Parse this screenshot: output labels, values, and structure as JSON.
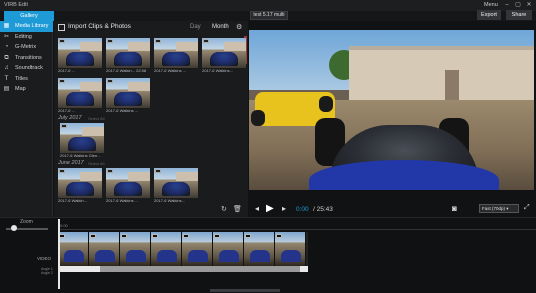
{
  "titlebar": {
    "title": "VIRB Edit",
    "menu_label": "Menu",
    "min": "–",
    "max": "▢",
    "close": "✕"
  },
  "topbar": {
    "gallery_label": "Gallery",
    "project_name": "test 5.17 multi",
    "export_label": "Export",
    "share_label": "Share"
  },
  "sidebar": {
    "items": [
      {
        "label": "Media Library",
        "icon": "film-icon",
        "glyph": "▦"
      },
      {
        "label": "Editing",
        "icon": "scissors-icon",
        "glyph": "✂"
      },
      {
        "label": "G-Metrix",
        "icon": "gauge-icon",
        "glyph": "◔"
      },
      {
        "label": "Transitions",
        "icon": "transitions-icon",
        "glyph": "⧉"
      },
      {
        "label": "Soundtrack",
        "icon": "music-icon",
        "glyph": "♫"
      },
      {
        "label": "Titles",
        "icon": "titles-icon",
        "glyph": "T"
      },
      {
        "label": "Map",
        "icon": "map-icon",
        "glyph": "▤"
      }
    ]
  },
  "library": {
    "import_label": "Import Clips & Photos",
    "day_label": "Day",
    "month_label": "Month",
    "groups": [
      {
        "title": "July 2017",
        "select": "Select All"
      },
      {
        "title": "June 2017",
        "select": "Select All"
      }
    ],
    "captions": {
      "t1": "2017-6 ...",
      "t2": "2017-6 Watkin... 22:58",
      "t3": "2017-6 Watkins ...",
      "t4": "2017-6 Watkins...",
      "t5": "2017-6 ...",
      "t6": "2017-6 Watkins ...",
      "t7": "2017-6 Watkins Glen...",
      "t8": "2017-6 Watkin...",
      "t9": "2017-6 Watkins ...",
      "t10": "2017-6 Watkins..."
    }
  },
  "player": {
    "current_time": "0:00",
    "total_time": " / 25:43",
    "speed": "Fast (70dp)",
    "prev": "◂",
    "play": "▶",
    "next": "▸"
  },
  "timeline": {
    "zoom_label": "Zoom",
    "ruler_label": "0:00",
    "video_label": "VIDEO",
    "audio1_label": "Angle 1",
    "audio2_label": "Angle 2"
  },
  "colors": {
    "accent": "#1e9bd6",
    "background": "#111214"
  }
}
